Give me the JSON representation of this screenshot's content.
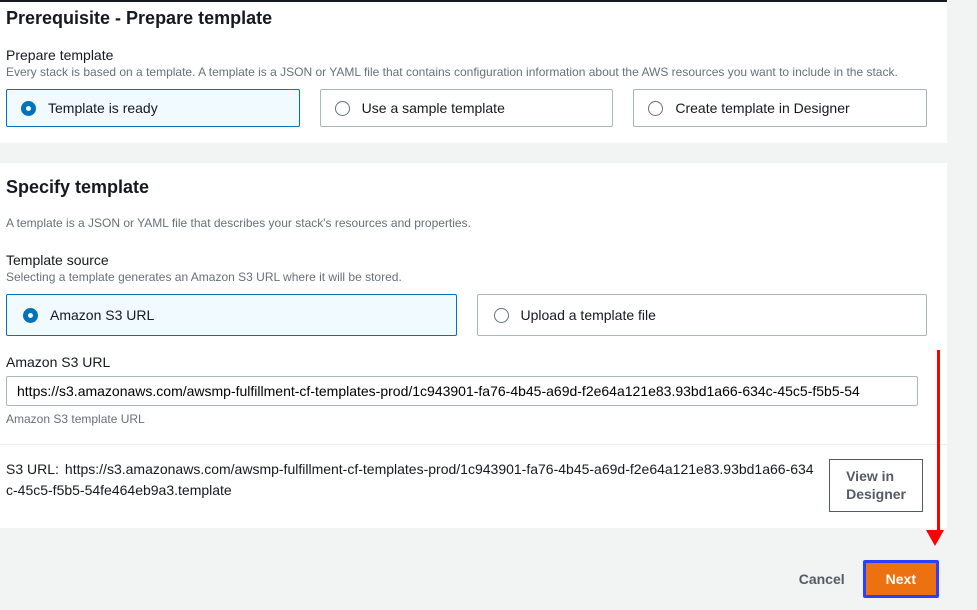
{
  "prereq": {
    "heading": "Prerequisite - Prepare template",
    "label": "Prepare template",
    "desc": "Every stack is based on a template. A template is a JSON or YAML file that contains configuration information about the AWS resources you want to include in the stack.",
    "options": {
      "ready": "Template is ready",
      "sample": "Use a sample template",
      "designer": "Create template in Designer"
    }
  },
  "specify": {
    "heading": "Specify template",
    "desc": "A template is a JSON or YAML file that describes your stack's resources and properties.",
    "source_label": "Template source",
    "source_desc": "Selecting a template generates an Amazon S3 URL where it will be stored.",
    "options": {
      "s3": "Amazon S3 URL",
      "upload": "Upload a template file"
    },
    "url_label": "Amazon S3 URL",
    "url_value": "https://s3.amazonaws.com/awsmp-fulfillment-cf-templates-prod/1c943901-fa76-4b45-a69d-f2e64a121e83.93bd1a66-634c-45c5-f5b5-54",
    "url_help": "Amazon S3 template URL",
    "s3url_label": "S3 URL:",
    "s3url_value": "https://s3.amazonaws.com/awsmp-fulfillment-cf-templates-prod/1c943901-fa76-4b45-a69d-f2e64a121e83.93bd1a66-634c-45c5-f5b5-54fe464eb9a3.template",
    "view_btn": "View in Designer"
  },
  "footer": {
    "cancel": "Cancel",
    "next": "Next"
  }
}
